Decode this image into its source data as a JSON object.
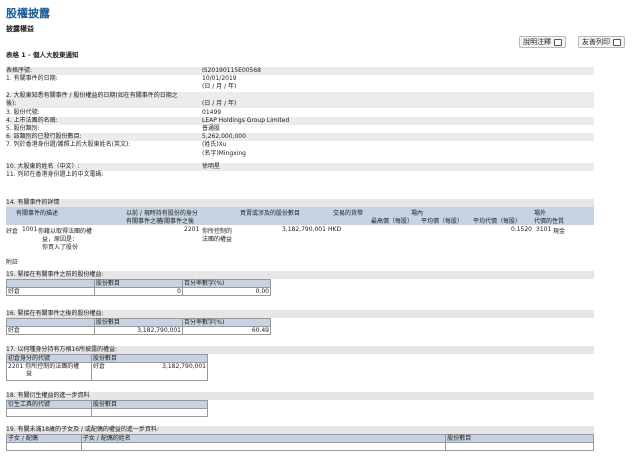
{
  "title": "股權披露",
  "subtitle": "披露權益",
  "form_title": "表格 1 - 個人大股東通知",
  "buttons": {
    "help": "說明注釋",
    "print": "友善列印"
  },
  "info_rows": [
    {
      "label": "表格序號:",
      "value": "IS20190115E00568"
    },
    {
      "label": "1. 有關事件的日期:",
      "value": "10/01/2019"
    },
    {
      "label": "",
      "value": "(日 / 月 / 年)"
    },
    {
      "label": "2. 大股東知悉有關事件 / 股份權益的日期(如在有關事件的日期之",
      "value": ""
    },
    {
      "label": "後):",
      "value": "(日 / 月 / 年)"
    },
    {
      "label": "3. 股份代號:",
      "value": "01499"
    },
    {
      "label": "4. 上市法團的名稱:",
      "value": "LEAP Holdings Group Limited"
    },
    {
      "label": "5. 股份類別:",
      "value": "普通股"
    },
    {
      "label": "6. 該類別的已發行股份數目:",
      "value": "5,262,000,000"
    },
    {
      "label": "7. 列於香港身份證/護照上的大股東姓名(英文):",
      "value": "(姓氏)Xu"
    },
    {
      "label": "",
      "value": "(名字)Mingxing"
    },
    {
      "label": "",
      "value": ""
    },
    {
      "label": "10. 大股東的姓名（中文）:",
      "value": "徐明星"
    },
    {
      "label": "11. 列印在香港身份證上的中文電碼:",
      "value": ""
    }
  ],
  "sec14": {
    "title": "14. 有關事件的詳情",
    "h_event": "有關事件的描述",
    "h_before": "以前 / 現時持有股份的身分",
    "h_before2": "有關事件之前",
    "h_after": "有關事件之後",
    "h_shares": "買賣或涉及的股份數目",
    "h_currency": "交易的貨幣",
    "h_exchange": "場內",
    "h_high": "最高價（每股）",
    "h_avg": "平均價（每股）",
    "h_offex": "場外",
    "h_avg2": "平均代價（每股）",
    "h_nature": "代價的性質",
    "row": {
      "pos": "好倉",
      "code": "1001",
      "desc1": "你藉以取得法團的權",
      "desc2": "益，原因是：",
      "desc3": "你買入了股份",
      "code2": "2201",
      "cap1": "你所控制的",
      "cap2": "法團的權益",
      "shares": "3,182,790,001",
      "currency": "HKD",
      "avg2": "0.1520",
      "ncode": "3101",
      "nature": "現金"
    },
    "note": "附註"
  },
  "sec15": {
    "title": "15. 緊接在有關事件之前的股份權益:",
    "h_shares": "股份數目",
    "h_pct": "百分率數字(%)",
    "pos": "好倉",
    "shares": "0",
    "pct": "0.00"
  },
  "sec16": {
    "title": "16. 緊接在有關事件之後的股份權益:",
    "h_shares": "股份數目",
    "h_pct": "百分率數字(%)",
    "pos": "好倉",
    "shares": "3,182,790,001",
    "pct": "60.49"
  },
  "sec17": {
    "title": "17. 以何種身分持有方格16所披露的權益:",
    "h_code": "初倉身分的代號",
    "h_shares": "股份數目",
    "code": "2201",
    "desc1": "你所控制的法團的權",
    "desc2": "益",
    "pos": "好倉",
    "shares": "3,182,790,001"
  },
  "sec18": {
    "title": "18. 有關衍生權益的進一步資料",
    "h_code": "衍生工具的代號",
    "h_shares": "股份數目"
  },
  "sec19": {
    "title": "19. 有關未滿18歲的子女及 / 或配偶的權益的進一步資料:",
    "h_kin": "子女 / 配偶",
    "h_name": "子女 / 配偶的姓名",
    "h_shares": "股份數目"
  }
}
